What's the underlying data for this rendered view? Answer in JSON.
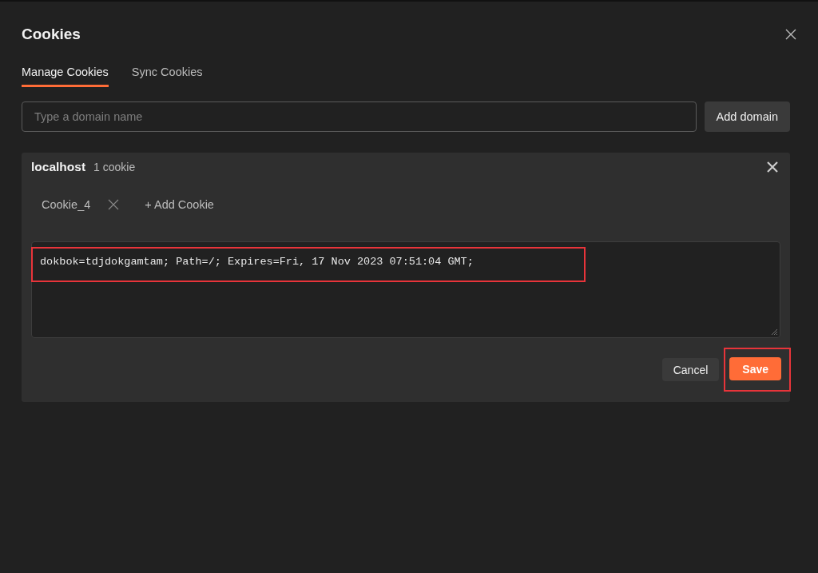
{
  "dialog": {
    "title": "Cookies"
  },
  "tabs": [
    {
      "label": "Manage Cookies",
      "selected": true
    },
    {
      "label": "Sync Cookies",
      "selected": false
    }
  ],
  "domain_input": {
    "placeholder": "Type a domain name"
  },
  "add_domain_button": "Add domain",
  "domains": [
    {
      "name": "localhost",
      "count": "1 cookie",
      "cookies": [
        {
          "name": "Cookie_4"
        }
      ],
      "add_cookie": "+ Add Cookie",
      "editor": {
        "value": "dokbok=tdjdokgamtam; Path=/; Expires=Fri, 17 Nov 2023 07:51:04 GMT;",
        "highlighted": true
      },
      "cancel_button": "Cancel",
      "save_button": {
        "label": "Save",
        "highlighted": true
      }
    }
  ]
}
